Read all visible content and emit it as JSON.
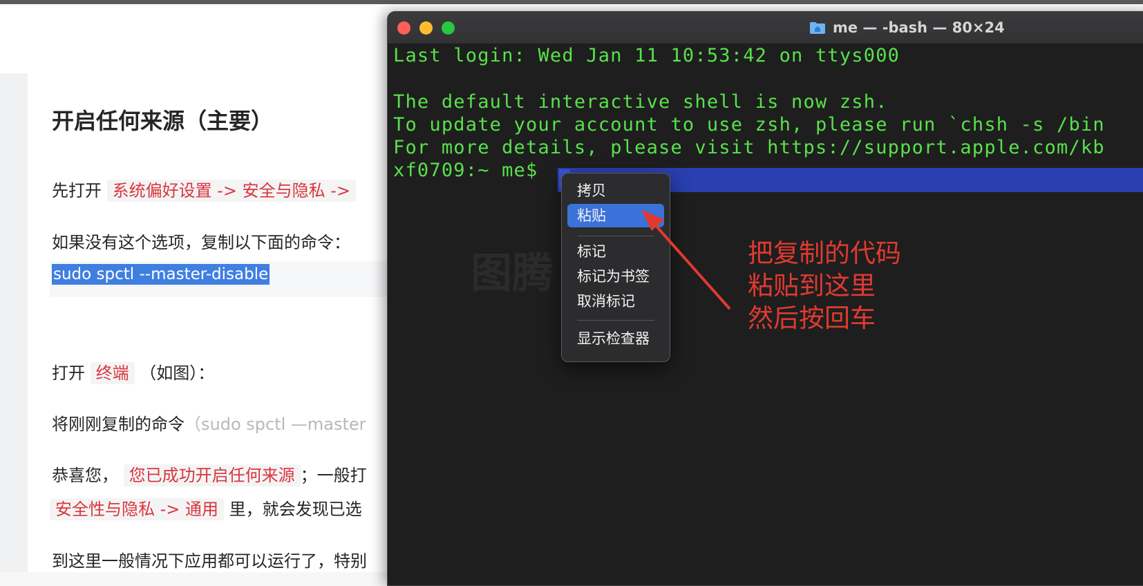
{
  "article": {
    "heading": "开启任何来源（主要）",
    "step1_prefix": "先打开",
    "step1_path": "系统偏好设置 -> 安全与隐私 ->",
    "fallback_text": "如果没有这个选项，复制以下面的命令：",
    "command": "sudo spctl --master-disable",
    "open_prefix": "打开",
    "open_terminal": "终端",
    "open_suffix": "（如图）：",
    "paste_prefix": "将刚刚复制的命令",
    "paste_muted": "（sudo spctl —master",
    "congrats_prefix": "恭喜您，",
    "congrats_highlight": "您已成功开启任何来源",
    "congrats_suffix": "；一般打",
    "security_path": "安全性与隐私 -> 通用",
    "security_suffix": " 里，就会发现已选",
    "final_text": "到这里一般情况下应用都可以运行了，特别"
  },
  "terminal": {
    "window_title": "me — -bash — 80×24",
    "lines": [
      "Last login: Wed Jan 11 10:53:42 on ttys000",
      "The default interactive shell is now zsh.",
      "To update your account to use zsh, please run `chsh -s /bin",
      "For more details, please visit https://support.apple.com/kb",
      "xf0709:~ me$"
    ]
  },
  "context_menu": {
    "items": [
      "拷贝",
      "粘贴",
      "标记",
      "标记为书签",
      "取消标记",
      "显示检查器"
    ],
    "active_item": "粘贴"
  },
  "annotation": {
    "lines": [
      "把复制的代码",
      "粘贴到这里",
      "然后按回车"
    ]
  },
  "colors": {
    "terminal_text": "#58e24b",
    "terminal_bg": "#1e1e1e",
    "highlight_red": "#d9363e",
    "annotation_red": "#e03a30",
    "selection_blue": "#3f7fe0",
    "menu_active": "#3b72d9"
  }
}
